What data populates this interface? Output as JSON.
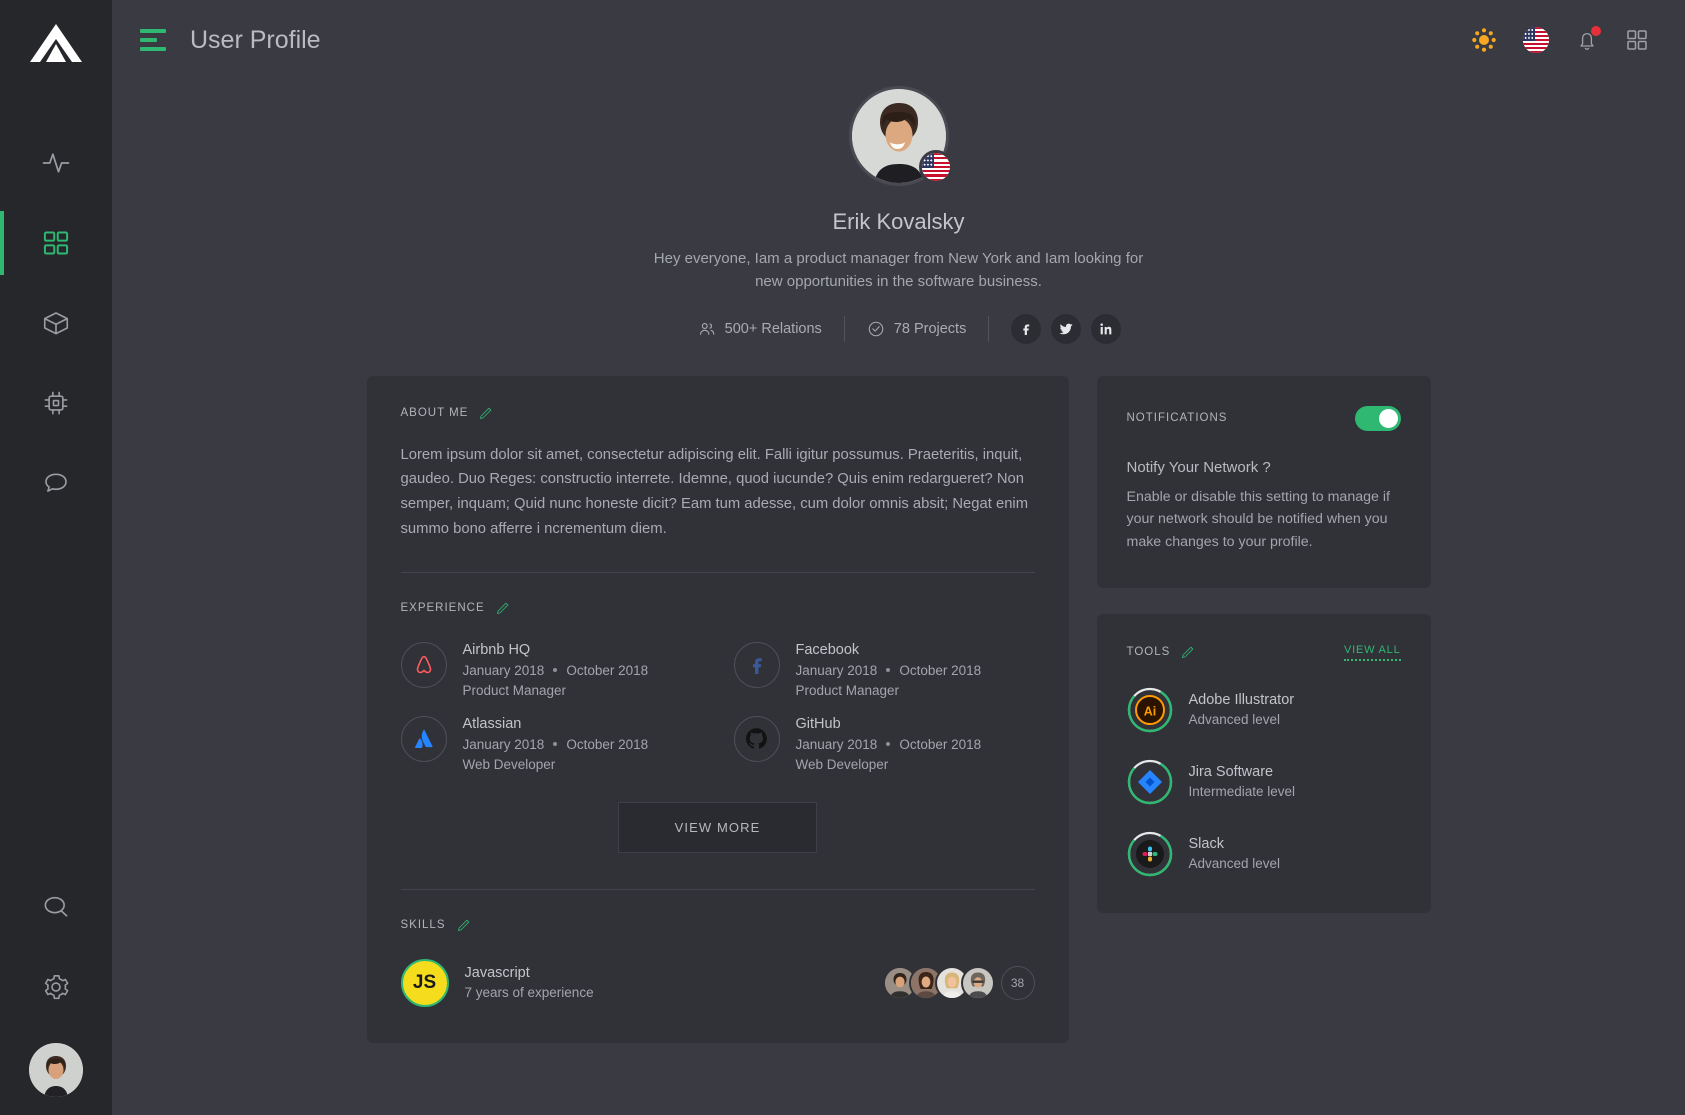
{
  "sidebar": {
    "logo_name": "triangle-logo",
    "items": [
      {
        "id": "activity",
        "icon": "activity-pulse-icon",
        "active": false
      },
      {
        "id": "dashboard",
        "icon": "grid-dashboard-icon",
        "active": true
      },
      {
        "id": "packages",
        "icon": "cube-box-icon",
        "active": false
      },
      {
        "id": "hardware",
        "icon": "cpu-chip-icon",
        "active": false
      },
      {
        "id": "messages",
        "icon": "chat-bubble-icon",
        "active": false
      }
    ],
    "bottom_items": [
      {
        "id": "search",
        "icon": "search-icon"
      },
      {
        "id": "settings",
        "icon": "gear-icon"
      }
    ],
    "avatar_name": "user-avatar"
  },
  "topbar": {
    "menu_icon": "hamburger-menu-icon",
    "title": "User Profile",
    "actions": [
      {
        "id": "theme",
        "icon": "sun-brightness-icon"
      },
      {
        "id": "language",
        "icon": "us-flag-icon"
      },
      {
        "id": "notifications",
        "icon": "bell-icon",
        "has_badge": true
      },
      {
        "id": "apps",
        "icon": "grid-apps-icon"
      }
    ]
  },
  "profile": {
    "name": "Erik Kovalsky",
    "bio": "Hey everyone,  Iam a product manager from New York and Iam looking for new opportunities in the software business.",
    "flag": "us-flag-icon",
    "relations": "500+ Relations",
    "projects": "78 Projects",
    "socials": [
      {
        "id": "facebook",
        "icon": "facebook-icon"
      },
      {
        "id": "twitter",
        "icon": "twitter-icon"
      },
      {
        "id": "linkedin",
        "icon": "linkedin-icon"
      }
    ]
  },
  "about": {
    "title": "ABOUT ME",
    "edit_icon": "pencil-edit-icon",
    "text": "Lorem ipsum dolor sit amet, consectetur adipiscing elit. Falli igitur possumus. Praeteritis, inquit, gaudeo. Duo Reges: constructio interrete. Idemne, quod iucunde? Quis enim redargueret? Non semper, inquam; Quid nunc honeste dicit? Eam tum adesse, cum dolor omnis absit; Negat enim summo bono afferre i ncrementum diem."
  },
  "experience": {
    "title": "EXPERIENCE",
    "edit_icon": "pencil-edit-icon",
    "items": [
      {
        "company": "Airbnb HQ",
        "logo": "airbnb-icon",
        "start": "January 2018",
        "end": "October 2018",
        "role": "Product Manager"
      },
      {
        "company": "Facebook",
        "logo": "facebook-icon",
        "start": "January 2018",
        "end": "October 2018",
        "role": "Product Manager"
      },
      {
        "company": "Atlassian",
        "logo": "atlassian-icon",
        "start": "January 2018",
        "end": "October 2018",
        "role": "Web Developer"
      },
      {
        "company": "GitHub",
        "logo": "github-icon",
        "start": "January 2018",
        "end": "October 2018",
        "role": "Web Developer"
      }
    ],
    "view_more_label": "VIEW MORE"
  },
  "skills": {
    "title": "SKILLS",
    "edit_icon": "pencil-edit-icon",
    "items": [
      {
        "badge": "JS",
        "name": "Javascript",
        "experience": "7 years of experience",
        "people_count": "38",
        "avatars": 4
      }
    ]
  },
  "notifications": {
    "title": "NOTIFICATIONS",
    "toggle_on": true,
    "question": "Notify Your Network ?",
    "description": "Enable or disable this setting to manage if your network should be notified when you make changes to your profile."
  },
  "tools": {
    "title": "TOOLS",
    "edit_icon": "pencil-edit-icon",
    "view_all_label": "VIEW ALL",
    "items": [
      {
        "name": "Adobe Illustrator",
        "level": "Advanced level",
        "icon": "adobe-illustrator-icon",
        "progress": 78
      },
      {
        "name": "Jira Software",
        "level": "Intermediate level",
        "icon": "jira-software-icon",
        "progress": 78
      },
      {
        "name": "Slack",
        "level": "Advanced level",
        "icon": "slack-icon",
        "progress": 78
      }
    ]
  },
  "colors": {
    "accent": "#2eb872",
    "bg": "#3a3b42",
    "card": "#313238",
    "sidebar": "#26272b",
    "badge": "#e8303a"
  }
}
